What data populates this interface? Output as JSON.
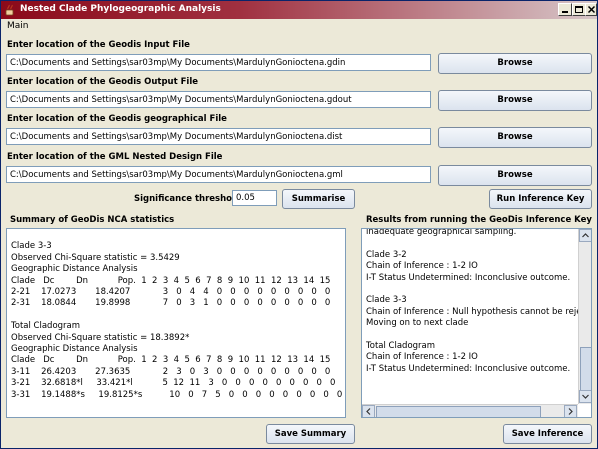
{
  "window": {
    "title": "Nested Clade Phylogeographic Analysis"
  },
  "menu": {
    "main": "Main"
  },
  "files": [
    {
      "label": "Enter location of the Geodis Input File",
      "value": "C:\\Documents and Settings\\sar03mp\\My Documents\\MardulynGonioctena.gdin",
      "button": "Browse"
    },
    {
      "label": "Enter location of the Geodis Output File",
      "value": "C:\\Documents and Settings\\sar03mp\\My Documents\\MardulynGonioctena.gdout",
      "button": "Browse"
    },
    {
      "label": "Enter location of the Geodis geographical File",
      "value": "C:\\Documents and Settings\\sar03mp\\My Documents\\MardulynGonioctena.dist",
      "button": "Browse"
    },
    {
      "label": "Enter location of the GML Nested Design File",
      "value": "C:\\Documents and Settings\\sar03mp\\My Documents\\MardulynGonioctena.gml",
      "button": "Browse"
    }
  ],
  "threshold": {
    "label": "Significance threshold",
    "value": "0.05"
  },
  "buttons": {
    "summarise": "Summarise",
    "run_key": "Run Inference Key",
    "save_summary": "Save Summary",
    "save_inference": "Save Inference"
  },
  "summary": {
    "heading": "Summary of GeoDis NCA statistics",
    "lines": [
      "",
      "Clade 3-3",
      "Observed Chi-Square statistic = 3.5429",
      "Geographic Distance Analysis",
      "Clade   Dc        Dn           Pop.  1  2  3  4  5  6  7  8  9  10  11  12  13  14  15",
      "2-21    17.0273       18.4207            3   0   4   4   0   0   0   0   0   0   0   0   0",
      "2-31    18.0844       19.8998            7   0   3   1   0   0   0   0   0   0   0   0   0",
      "",
      "Total Cladogram",
      "Observed Chi-Square statistic = 18.3892*",
      "Geographic Distance Analysis",
      "Clade   Dc        Dn           Pop.  1  2  3  4  5  6  7  8  9  10  11  12  13  14  15",
      "3-11    26.4203       27.3635            2   3   0   3   0   0   0   0   0   0   0   0   0",
      "3-21    32.6818*l     33.421*l           5  12  11   3   0   0   0   0   0   0   0   0   0",
      "3-31    19.1488*s     19.8125*s          10   0   7   5   0   0   0   0   0   0   0   0   0"
    ]
  },
  "results": {
    "heading": "Results from running the GeoDis Inference Key",
    "lines": [
      "inadequate geographical sampling.",
      "",
      "Clade 3-2",
      "Chain of Inference : 1-2 IO",
      "I-T Status Undetermined: Inconclusive outcome.",
      "",
      "Clade 3-3",
      "Chain of Inference : Null hypothesis cannot be rejected.",
      "Moving on to next clade",
      "",
      "Total Cladogram",
      "Chain of Inference : 1-2 IO",
      "I-T Status Undetermined: Inconclusive outcome."
    ]
  }
}
